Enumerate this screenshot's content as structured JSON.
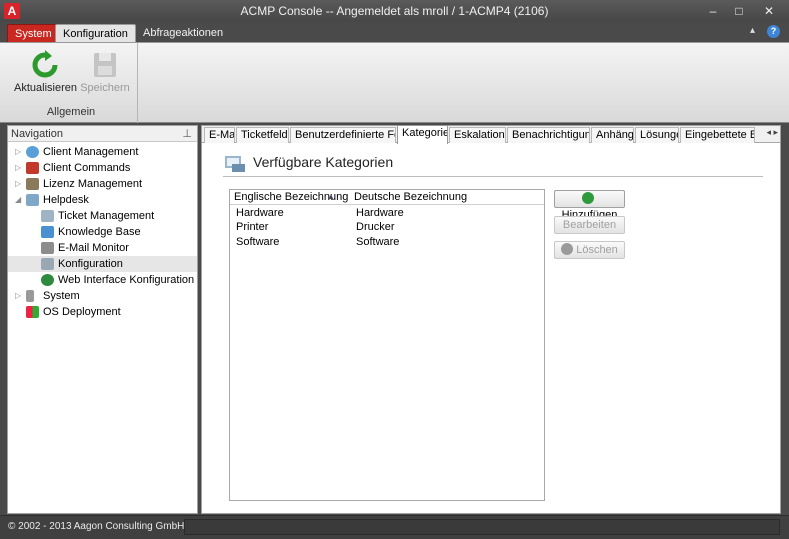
{
  "window": {
    "title": "ACMP Console -- Angemeldet als mroll / 1-ACMP4 (2106)",
    "app_icon": "A",
    "min": "–",
    "max": "□",
    "close": "✕"
  },
  "menu": {
    "system": "System",
    "konfiguration": "Konfiguration",
    "abfrage": "Abfrageaktionen",
    "collapse": "▴",
    "help": "?"
  },
  "ribbon": {
    "refresh_label": "Aktualisieren",
    "save_label": "Speichern",
    "group_label": "Allgemein"
  },
  "nav": {
    "header": "Navigation",
    "pin": "⊥",
    "items": [
      {
        "label": "Client Management",
        "expander": "▷"
      },
      {
        "label": "Client Commands",
        "expander": "▷"
      },
      {
        "label": "Lizenz Management",
        "expander": "▷"
      },
      {
        "label": "Helpdesk",
        "expander": "◢"
      },
      {
        "label": "Ticket Management"
      },
      {
        "label": "Knowledge Base"
      },
      {
        "label": "E-Mail Monitor"
      },
      {
        "label": "Konfiguration"
      },
      {
        "label": "Web Interface Konfiguration"
      },
      {
        "label": "System",
        "expander": "▷"
      },
      {
        "label": "OS Deployment"
      }
    ]
  },
  "tabs": [
    "E-Mail",
    "Ticketfelder",
    "Benutzerdefinierte Felder",
    "Kategorien",
    "Eskalationen",
    "Benachrichtigungen",
    "Anhänge",
    "Lösungen",
    "Eingebettete Bilder"
  ],
  "tab_scroll": "◂ ▸",
  "main": {
    "heading": "Verfügbare Kategorien",
    "col_en": "Englische Bezeichnung",
    "col_de": "Deutsche Bezeichnung",
    "sort": "▲",
    "rows": [
      {
        "en": "Hardware",
        "de": "Hardware"
      },
      {
        "en": "Printer",
        "de": "Drucker"
      },
      {
        "en": "Software",
        "de": "Software"
      }
    ],
    "add_label": "Hinzufügen",
    "edit_label": "Bearbeiten",
    "delete_label": "Löschen"
  },
  "status": {
    "text": "© 2002 - 2013 Aagon Consulting GmbH"
  }
}
